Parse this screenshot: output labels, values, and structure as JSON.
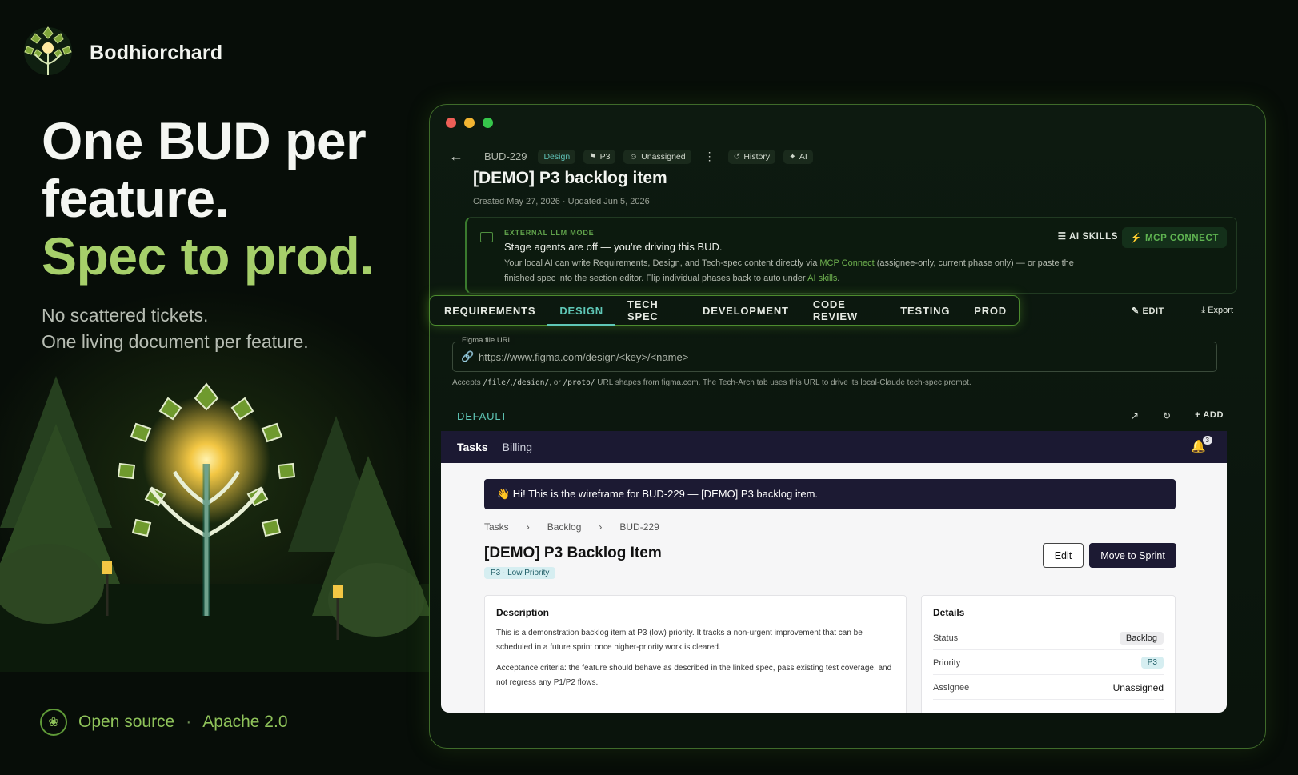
{
  "brand": {
    "name": "Bodhiorchard"
  },
  "hero": {
    "line1": "One BUD per",
    "line2": "feature.",
    "line3": "Spec to prod.",
    "sub1": "No scattered tickets.",
    "sub2": "One living document per feature."
  },
  "footer": {
    "open_source": "Open source",
    "separator": "·",
    "license": "Apache 2.0"
  },
  "colors": {
    "accent_green": "#a6cf6a",
    "accent_teal": "#5fc7b7",
    "brand_dark": "#1c1a33"
  },
  "app": {
    "bud_id": "BUD-229",
    "chips": {
      "phase": "Design",
      "priority": "P3",
      "assignee": "Unassigned",
      "history": "History",
      "ai": "AI"
    },
    "title": "[DEMO] P3 backlog item",
    "created": "Created May 27, 2026 · Updated Jun 5, 2026",
    "llm": {
      "label": "EXTERNAL LLM MODE",
      "heading": "Stage agents are off — you're driving this BUD.",
      "text_a": "Your local AI can write Requirements, Design, and Tech-spec content directly via ",
      "link_a": "MCP Connect",
      "text_b": " (assignee-only, current phase only) — or paste the finished spec into the section editor. Flip individual phases back to auto under ",
      "link_b": "AI skills",
      "text_c": ".",
      "ai_skills": "AI SKILLS",
      "mcp_connect": "MCP CONNECT"
    },
    "tabs": [
      "REQUIREMENTS",
      "DESIGN",
      "TECH SPEC",
      "DEVELOPMENT",
      "CODE REVIEW",
      "TESTING",
      "PROD"
    ],
    "active_tab": "DESIGN",
    "edit": "EDIT",
    "export": "Export",
    "figma": {
      "label": "Figma file URL",
      "placeholder": "https://www.figma.com/design/<key>/<name>",
      "hint_a": "Accepts ",
      "hint_c1": "/file/",
      "hint_c2": "/design/",
      "hint_c3": "/proto/",
      "hint_b": " URL shapes from figma.com. The Tech-Arch tab uses this URL to drive its local-Claude tech-spec prompt."
    },
    "frame_tab": "DEFAULT",
    "add": "+ ADD"
  },
  "wireframe": {
    "nav": [
      "Tasks",
      "Billing"
    ],
    "notifications": "3",
    "banner": "👋 Hi! This is the wireframe for BUD-229 — [DEMO] P3 backlog item.",
    "breadcrumb": [
      "Tasks",
      "Backlog",
      "BUD-229"
    ],
    "title": "[DEMO] P3 Backlog Item",
    "priority_badge": "P3 · Low Priority",
    "edit_button": "Edit",
    "move_button": "Move to Sprint",
    "description": {
      "heading": "Description",
      "p1": "This is a demonstration backlog item at P3 (low) priority. It tracks a non-urgent improvement that can be scheduled in a future sprint once higher-priority work is cleared.",
      "p2": "Acceptance criteria: the feature should behave as described in the linked spec, pass existing test coverage, and not regress any P1/P2 flows."
    },
    "details": {
      "heading": "Details",
      "rows": [
        {
          "label": "Status",
          "value": "Backlog"
        },
        {
          "label": "Priority",
          "value": "P3"
        },
        {
          "label": "Assignee",
          "value": "Unassigned"
        }
      ]
    }
  }
}
